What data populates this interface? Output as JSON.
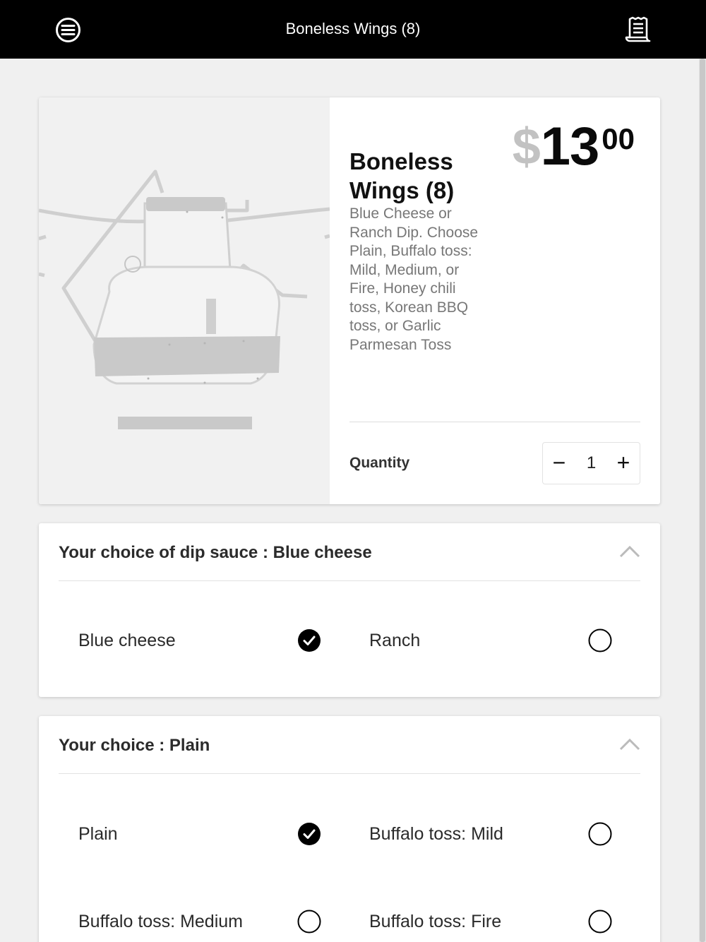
{
  "header": {
    "title": "Boneless Wings (8)",
    "menu_icon": "hamburger-menu-icon",
    "receipt_icon": "receipt-icon"
  },
  "product": {
    "name": "Boneless Wings (8)",
    "description": "Blue Cheese or Ranch Dip. Choose Plain, Buffalo toss: Mild, Medium, or Fire, Honey chili toss, Korean BBQ toss, or Garlic Parmesan Toss",
    "price": {
      "currency": "$",
      "dollars": "13",
      "cents": "00"
    },
    "quantity_label": "Quantity",
    "quantity": "1",
    "decrement_label": "−",
    "increment_label": "+"
  },
  "dip_section": {
    "title": "Your choice of dip sauce : Blue cheese",
    "options": [
      {
        "label": "Blue cheese",
        "selected": true
      },
      {
        "label": "Ranch",
        "selected": false
      }
    ]
  },
  "choice_section": {
    "title": "Your choice : Plain",
    "options": [
      {
        "label": "Plain",
        "selected": true
      },
      {
        "label": "Buffalo toss: Mild",
        "selected": false
      },
      {
        "label": "Buffalo toss: Medium",
        "selected": false
      },
      {
        "label": "Buffalo toss: Fire",
        "selected": false
      }
    ]
  },
  "colors": {
    "topbar_bg": "#000000",
    "page_bg": "#f0f0f0",
    "price_currency": "#c2c2c2",
    "selected_radio": "#000000"
  }
}
